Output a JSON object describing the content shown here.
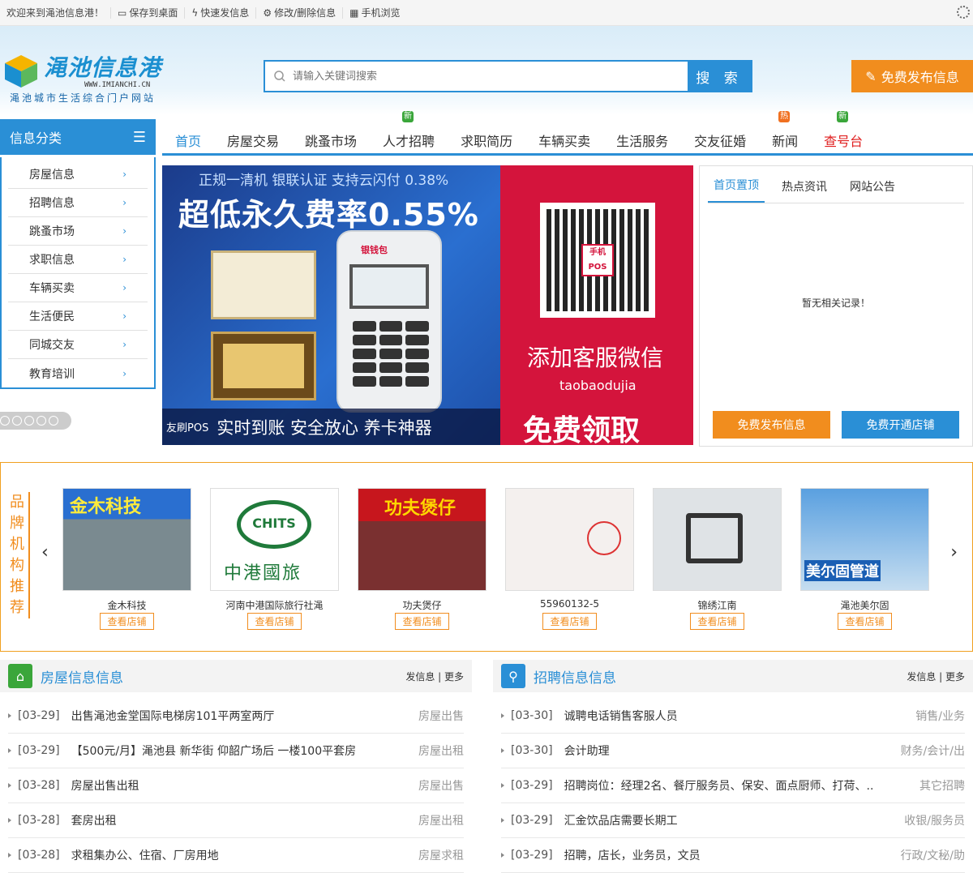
{
  "topbar": {
    "welcome": "欢迎来到渑池信息港！",
    "save_desktop": "保存到桌面",
    "quick_post": "快速发信息",
    "edit_delete": "修改/删除信息",
    "mobile": "手机浏览"
  },
  "logo": {
    "title": "渑池信息港",
    "url": "WWW.IMIANCHI.CN",
    "slogan": "渑池城市生活综合门户网站"
  },
  "search": {
    "placeholder": "请输入关键词搜索",
    "button": "搜 索"
  },
  "publish_button": "免费发布信息",
  "category_title": "信息分类",
  "nav": [
    {
      "label": "首页",
      "badge": ""
    },
    {
      "label": "房屋交易",
      "badge": ""
    },
    {
      "label": "跳蚤市场",
      "badge": ""
    },
    {
      "label": "人才招聘",
      "badge": "新"
    },
    {
      "label": "求职简历",
      "badge": ""
    },
    {
      "label": "车辆买卖",
      "badge": ""
    },
    {
      "label": "生活服务",
      "badge": ""
    },
    {
      "label": "交友征婚",
      "badge": ""
    },
    {
      "label": "新闻",
      "badge": "热"
    },
    {
      "label": "查号台",
      "badge": "新"
    }
  ],
  "categories": [
    "房屋信息",
    "招聘信息",
    "跳蚤市场",
    "求职信息",
    "车辆买卖",
    "生活便民",
    "同城交友",
    "教育培训"
  ],
  "banner": {
    "line1": "正规一清机 银联认证 支持云闪付 0.38%",
    "line2": "超低永久费率0.55%",
    "bottom_small": "友刷POS",
    "bottom_big": "实时到账 安全放心 养卡神器",
    "qr_badge": "手机POS",
    "add_wechat": "添加客服微信",
    "wechat_id": "taobaodujia",
    "free": "免费领取",
    "pos_brand": "银钱包"
  },
  "sidebox": {
    "tabs": [
      "首页置顶",
      "热点资讯",
      "网站公告"
    ],
    "empty": "暂无相关记录！",
    "btn_publish": "免费发布信息",
    "btn_shop": "免费开通店铺"
  },
  "brand": {
    "label": "品牌机构推荐",
    "view": "查看店铺",
    "shops": [
      {
        "name": "金木科技",
        "sign": "金木科技"
      },
      {
        "name": "河南中港国际旅行社渑",
        "sign": "中港國旅",
        "logo": "CHITS"
      },
      {
        "name": "功夫煲仔",
        "sign": "功夫煲仔"
      },
      {
        "name": "55960132-5",
        "sign": ""
      },
      {
        "name": "锦绣江南",
        "sign": ""
      },
      {
        "name": "渑池美尔固",
        "sign": "美尔固管道"
      }
    ]
  },
  "house": {
    "title": "房屋信息信息",
    "more": "发信息 | 更多",
    "rows": [
      {
        "date": "[03-29]",
        "text": "出售渑池金堂国际电梯房101平两室两厅",
        "cat": "房屋出售"
      },
      {
        "date": "[03-29]",
        "text": "【500元/月】渑池县 新华街 仰韶广场后 一楼100平套房",
        "cat": "房屋出租"
      },
      {
        "date": "[03-28]",
        "text": "房屋出售出租",
        "cat": "房屋出售"
      },
      {
        "date": "[03-28]",
        "text": "套房出租",
        "cat": "房屋出租"
      },
      {
        "date": "[03-28]",
        "text": "求租集办公、住宿、厂房用地",
        "cat": "房屋求租"
      }
    ]
  },
  "jobs": {
    "title": "招聘信息信息",
    "more": "发信息 | 更多",
    "rows": [
      {
        "date": "[03-30]",
        "text": "诚聘电话销售客服人员",
        "cat": "销售/业务"
      },
      {
        "date": "[03-30]",
        "text": "会计助理",
        "cat": "财务/会计/出"
      },
      {
        "date": "[03-29]",
        "text": "招聘岗位：经理2名、餐厅服务员、保安、面点厨师、打荷、..",
        "cat": "其它招聘"
      },
      {
        "date": "[03-29]",
        "text": "汇金饮品店需要长期工",
        "cat": "收银/服务员"
      },
      {
        "date": "[03-29]",
        "text": "招聘，店长，业务员，文员",
        "cat": "行政/文秘/助"
      }
    ]
  }
}
